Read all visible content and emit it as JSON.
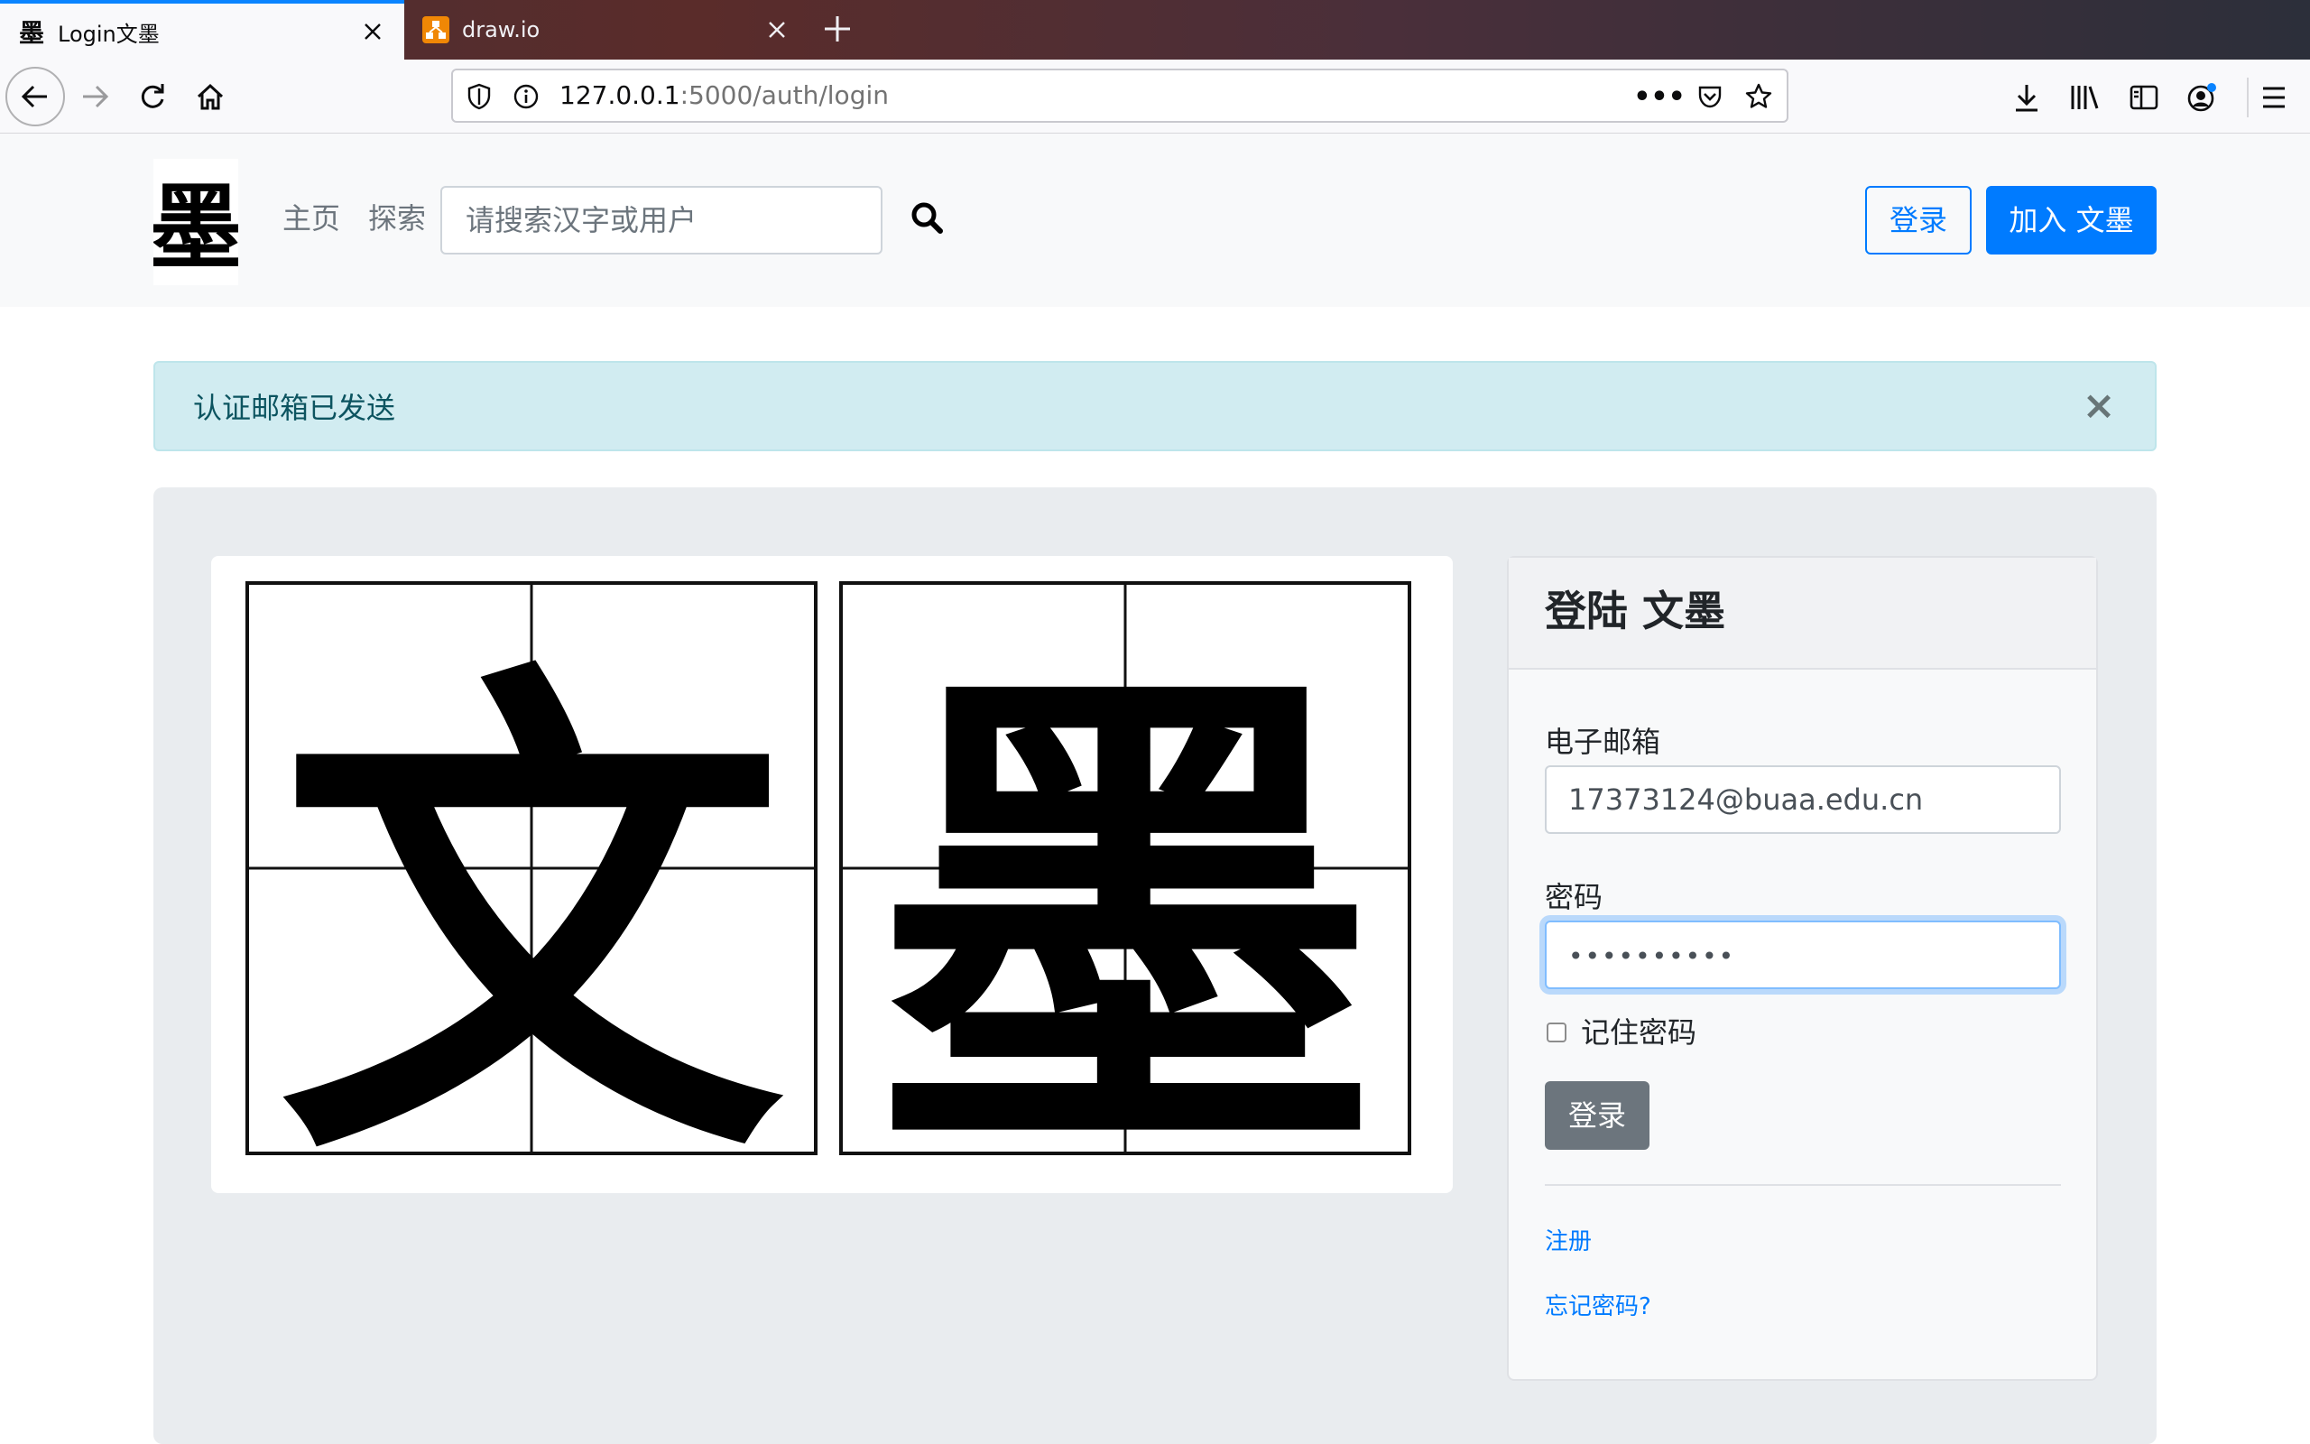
{
  "browser": {
    "tabs": [
      {
        "title": "Login文墨",
        "favicon": "墨"
      },
      {
        "title": "draw.io"
      }
    ],
    "url_host": "127.0.0.1",
    "url_path": ":5000/auth/login",
    "page_actions_icon": "•••",
    "colors": {
      "accent": "#0a84ff"
    }
  },
  "navbar": {
    "brand_char": "墨",
    "links": [
      "主页",
      "探索"
    ],
    "search_placeholder": "请搜索汉字或用户",
    "login_label": "登录",
    "join_label": "加入 文墨"
  },
  "alert": {
    "message": "认证邮箱已发送",
    "close_glyph": "×",
    "colors": {
      "bg": "#d1ecf1",
      "text": "#0c5460"
    }
  },
  "art": {
    "chars": [
      "文",
      "墨"
    ]
  },
  "login_card": {
    "title": "登陆 文墨",
    "email_label": "电子邮箱",
    "email_value": "17373124@buaa.edu.cn",
    "password_label": "密码",
    "password_value": "••••••••••",
    "remember_label": "记住密码",
    "remember_checked": false,
    "submit_label": "登录",
    "register_link": "注册",
    "forgot_link": "忘记密码?"
  },
  "colors": {
    "primary": "#007bff",
    "secondary": "#6c757d",
    "jumbotron": "#e9ecef"
  }
}
